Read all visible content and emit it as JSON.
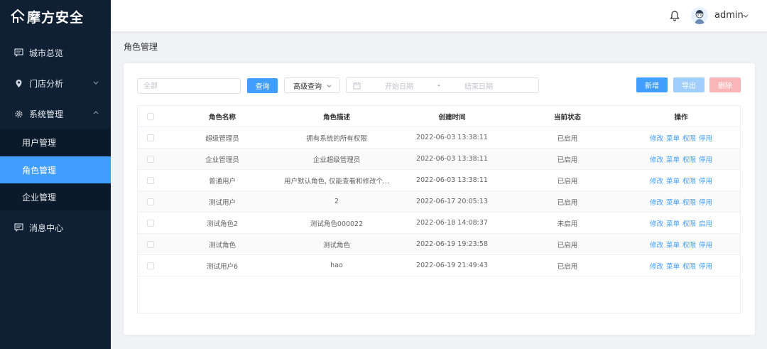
{
  "brand": {
    "name": "摩方安全"
  },
  "sidebar": {
    "items": [
      {
        "label": "城市总览",
        "icon": "message-square-icon"
      },
      {
        "label": "门店分析",
        "icon": "location-pin-icon"
      },
      {
        "label": "系统管理",
        "icon": "gear-icon"
      },
      {
        "label": "消息中心",
        "icon": "message-square-icon"
      }
    ],
    "submenu": [
      {
        "label": "用户管理",
        "active": false
      },
      {
        "label": "角色管理",
        "active": true
      },
      {
        "label": "企业管理",
        "active": false
      }
    ]
  },
  "header": {
    "username": "admin"
  },
  "breadcrumb": "角色管理",
  "toolbar": {
    "search_placeholder": "全部",
    "query_label": "查询",
    "advanced_label": "高级查询",
    "date_start_placeholder": "开始日期",
    "date_separator": "-",
    "date_end_placeholder": "结束日期",
    "add_label": "新增",
    "export_label": "导出",
    "delete_label": "删除"
  },
  "table": {
    "columns": [
      "角色名称",
      "角色描述",
      "创建时间",
      "当前状态",
      "操作"
    ],
    "rows": [
      {
        "name": "超级管理员",
        "desc": "拥有系统的所有权限",
        "time": "2022-06-03 13:38:11",
        "status": "已启用",
        "ops": [
          "修改",
          "菜单",
          "权限",
          "停用"
        ]
      },
      {
        "name": "企业管理员",
        "desc": "企业超级管理员",
        "time": "2022-06-03 13:38:11",
        "status": "已启用",
        "ops": [
          "修改",
          "菜单",
          "权限",
          "停用"
        ]
      },
      {
        "name": "普通用户",
        "desc": "用户默认角色, 仅能查看和修改个...",
        "time": "2022-06-03 13:38:11",
        "status": "已启用",
        "ops": [
          "修改",
          "菜单",
          "权限",
          "停用"
        ]
      },
      {
        "name": "测试用户",
        "desc": "2",
        "time": "2022-06-17 20:05:13",
        "status": "已启用",
        "ops": [
          "修改",
          "菜单",
          "权限",
          "停用"
        ]
      },
      {
        "name": "测试角色2",
        "desc": "测试角色000022",
        "time": "2022-06-18 14:08:37",
        "status": "未启用",
        "ops": [
          "修改",
          "菜单",
          "权限",
          "启用"
        ]
      },
      {
        "name": "测试角色",
        "desc": "测试角色",
        "time": "2022-06-19 19:23:58",
        "status": "已启用",
        "ops": [
          "修改",
          "菜单",
          "权限",
          "停用"
        ]
      },
      {
        "name": "测试用户6",
        "desc": "hao",
        "time": "2022-06-19 21:49:43",
        "status": "已启用",
        "ops": [
          "修改",
          "菜单",
          "权限",
          "停用"
        ]
      }
    ]
  },
  "colors": {
    "sidebar_bg": "#0f2034",
    "accent": "#409eff",
    "export_disabled": "#a0cfff",
    "delete_disabled": "#fab6b6"
  }
}
